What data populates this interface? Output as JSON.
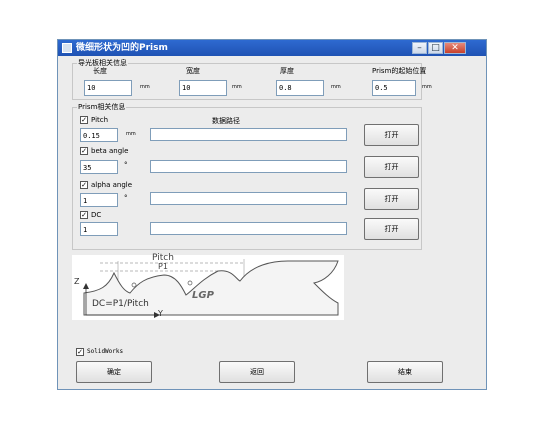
{
  "window": {
    "title": "微细形状为凹的Prism",
    "controls": {
      "minimize": "–",
      "maximize": "□",
      "close": "✕"
    }
  },
  "light_guide": {
    "group_label": "导光板相关信息",
    "fields": [
      {
        "label": "长度",
        "value": "10",
        "unit": "mm"
      },
      {
        "label": "宽度",
        "value": "10",
        "unit": "mm"
      },
      {
        "label": "厚度",
        "value": "0.8",
        "unit": "mm"
      },
      {
        "label": "Prism的起始位置",
        "value": "0.5",
        "unit": "mm"
      }
    ]
  },
  "prism": {
    "group_label": "Prism相关信息",
    "path_header": "数据路径",
    "open_label": "打开",
    "rows": [
      {
        "label": "Pitch",
        "checked": true,
        "value": "0.15",
        "unit": "mm",
        "path": ""
      },
      {
        "label": "beta angle",
        "checked": true,
        "value": "35",
        "unit": "°",
        "path": ""
      },
      {
        "label": "alpha angle",
        "checked": true,
        "value": "1",
        "unit": "°",
        "path": ""
      },
      {
        "label": "DC",
        "checked": true,
        "value": "1",
        "unit": "",
        "path": ""
      }
    ]
  },
  "figure": {
    "pitch": "Pitch",
    "p1": "P1",
    "lgp": "LGP",
    "formula": "DC=P1/Pitch",
    "axis_z": "Z",
    "axis_y": "Y"
  },
  "solidworks": {
    "label": "SolidWorks",
    "checked": true
  },
  "buttons": {
    "ok": "确定",
    "back": "返回",
    "finish": "结束"
  }
}
